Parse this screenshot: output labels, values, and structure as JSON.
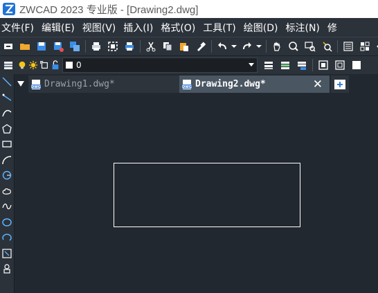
{
  "window": {
    "title": "ZWCAD 2023 专业版 - [Drawing2.dwg]",
    "app_icon": "zwcad-logo-icon"
  },
  "menu": {
    "items": [
      {
        "label": "文件(F)"
      },
      {
        "label": "编辑(E)"
      },
      {
        "label": "视图(V)"
      },
      {
        "label": "插入(I)"
      },
      {
        "label": "格式(O)"
      },
      {
        "label": "工具(T)"
      },
      {
        "label": "绘图(D)"
      },
      {
        "label": "标注(N)"
      },
      {
        "label": "修"
      }
    ]
  },
  "toolbar": {
    "icons": [
      "new-icon",
      "open-icon",
      "save-icon",
      "save-as-icon",
      "save-all-icon",
      "print-icon",
      "print-preview-icon",
      "plot-icon",
      "cut-icon",
      "copy-icon",
      "paste-icon",
      "match-properties-icon",
      "undo-icon",
      "redo-icon",
      "pan-icon",
      "zoom-realtime-icon",
      "zoom-window-icon",
      "zoom-previous-icon",
      "properties-icon",
      "design-center-icon",
      "layer-states-icon"
    ]
  },
  "layer_toolbar": {
    "current_layer": "0",
    "layer_color": "#ffffff"
  },
  "tabs": [
    {
      "label": "Drawing1.dwg*",
      "active": false
    },
    {
      "label": "Drawing2.dwg*",
      "active": true
    }
  ],
  "tab_close_glyph": "✕",
  "colors": {
    "background": "#212830",
    "toolbar": "#2b323a",
    "active_tab": "#4a5661",
    "accent_blue": "#3a8ee6",
    "icon_yellow": "#f5c518"
  }
}
